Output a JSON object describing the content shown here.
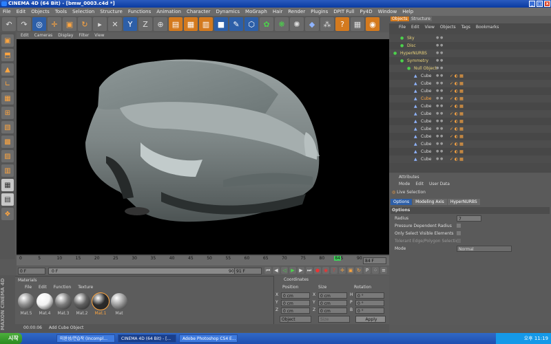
{
  "window": {
    "title": "CINEMA 4D (64 Bit) - [bmw_0003.c4d *]"
  },
  "menu": [
    "File",
    "Edit",
    "Objects",
    "Tools",
    "Selection",
    "Structure",
    "Functions",
    "Animation",
    "Character",
    "Dynamics",
    "MoGraph",
    "Hair",
    "Render",
    "Plugins",
    "DPIT Full",
    "Py4D",
    "Window",
    "Help"
  ],
  "viewport_menu": [
    "Edit",
    "Cameras",
    "Display",
    "Filter",
    "View"
  ],
  "timeline": {
    "ticks": [
      "0",
      "5",
      "10",
      "15",
      "20",
      "25",
      "30",
      "35",
      "40",
      "45",
      "50",
      "55",
      "60",
      "65",
      "70",
      "75",
      "80",
      "84",
      "85",
      "90"
    ],
    "current_frame": "84",
    "end_field": "84 F",
    "start_field": "0 F",
    "min_field": "0 F",
    "max_field": "90 F",
    "fps_field": "91 F"
  },
  "materials": {
    "title": "Materials",
    "menu": [
      "File",
      "Edit",
      "Function",
      "Texture"
    ],
    "items": [
      {
        "label": "Mat.5",
        "color": "#8a8a8a"
      },
      {
        "label": "Mat.4",
        "color": "#f2f2f2"
      },
      {
        "label": "Mat.3",
        "color": "#7a7a7a"
      },
      {
        "label": "Mat.2",
        "color": "#5f5f5f"
      },
      {
        "label": "Mat.1",
        "color": "#2b2b2b",
        "selected": true
      },
      {
        "label": "Mat",
        "color": "#9c9c9c"
      }
    ]
  },
  "coordinates": {
    "title": "Coordinates",
    "headers": [
      "Position",
      "Size",
      "Rotation"
    ],
    "rows": [
      {
        "axis": "X",
        "pos": "0 cm",
        "size_axis": "X",
        "size": "0 cm",
        "rot_axis": "H",
        "rot": "0 °"
      },
      {
        "axis": "Y",
        "pos": "0 cm",
        "size_axis": "Y",
        "size": "0 cm",
        "rot_axis": "P",
        "rot": "0 °"
      },
      {
        "axis": "Z",
        "pos": "0 cm",
        "size_axis": "Z",
        "size": "0 cm",
        "rot_axis": "B",
        "rot": "0 °"
      }
    ],
    "mode": "Object",
    "size_mode": "Size",
    "apply": "Apply"
  },
  "objects": {
    "tabs": [
      "Objects",
      "Structure"
    ],
    "menu": [
      "File",
      "Edit",
      "View",
      "Objects",
      "Tags",
      "Bookmarks"
    ],
    "rows": [
      {
        "name": "Sky",
        "indent": 1
      },
      {
        "name": "Disc",
        "indent": 1
      },
      {
        "name": "HyperNURBS",
        "indent": 0
      },
      {
        "name": "Symmetry",
        "indent": 1
      },
      {
        "name": "Null Object",
        "indent": 2
      },
      {
        "name": "Cube",
        "indent": 3
      },
      {
        "name": "Cube",
        "indent": 3
      },
      {
        "name": "Cube",
        "indent": 3
      },
      {
        "name": "Cube",
        "indent": 3,
        "selected": true
      },
      {
        "name": "Cube",
        "indent": 3
      },
      {
        "name": "Cube",
        "indent": 3
      },
      {
        "name": "Cube",
        "indent": 3
      },
      {
        "name": "Cube",
        "indent": 3
      },
      {
        "name": "Cube",
        "indent": 3
      },
      {
        "name": "Cube",
        "indent": 3
      },
      {
        "name": "Cube",
        "indent": 3
      },
      {
        "name": "Cube",
        "indent": 3
      }
    ]
  },
  "attributes": {
    "title": "Attributes",
    "menu": [
      "Mode",
      "Edit",
      "User Data"
    ],
    "tool": "Live Selection",
    "tabs": [
      "Options",
      "Modeling Axis",
      "HyperNURBS"
    ],
    "section": "Options",
    "radius_label": "Radius",
    "radius_value": "7",
    "pressure_label": "Pressure Dependent Radius",
    "only_visible_label": "Only Select Visible Elements",
    "tolerant_label": "Tolerant Edge/Polygon Selection",
    "mode_label": "Mode",
    "mode_value": "Normal"
  },
  "status": {
    "time": "00:00:06",
    "message": "Add Cube Object"
  },
  "taskbar": {
    "start": "시작",
    "tasks": [
      "미완성/연습작 (Incompl...",
      "CINEMA 4D (64 Bit) - [...",
      "Adobe Photoshop CS4 E..."
    ],
    "clock": "오후 11:19"
  },
  "brand": "MAXON CINEMA 4D"
}
